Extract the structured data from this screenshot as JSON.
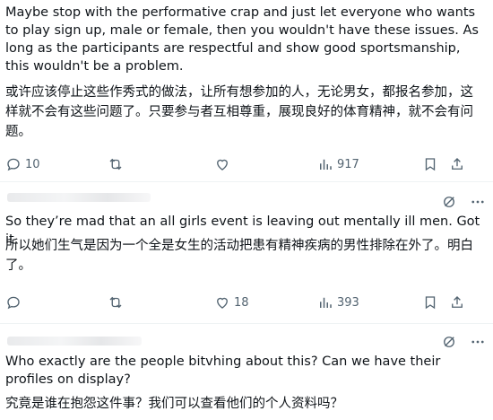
{
  "posts": [
    {
      "text_en": "Maybe stop with the performative crap and just let everyone who wants to play sign up, male or female, then you wouldn't have these issues. As long as the participants are respectful and show good sportsmanship, this wouldn't be a problem.",
      "text_zh": "或许应该停止这些作秀式的做法，让所有想参加的人，无论男女，都报名参加，这样就不会有这些问题了。只要参与者互相尊重，展现良好的体育精神，就不会有问题。",
      "replies": "10",
      "reposts": "",
      "likes": "",
      "views": "917"
    },
    {
      "text_en": "So they’re mad that an all girls event is leaving out mentally ill men. Got it.",
      "text_zh": "所以她们生气是因为一个全是女生的活动把患有精神疾病的男性排除在外了。明白了。",
      "replies": "",
      "reposts": "",
      "likes": "18",
      "views": "393"
    },
    {
      "text_en": "Who exactly are the people bitvhing about this? Can we have their profiles on display?",
      "text_zh": "究竟是谁在抱怨这件事？我们可以查看他们的个人资料吗？"
    }
  ],
  "icons": {
    "reply": "reply-icon",
    "repost": "repost-icon",
    "like": "heart-icon",
    "views": "views-icon",
    "bookmark": "bookmark-icon",
    "share": "share-icon",
    "grok": "grok-icon",
    "more": "more-icon"
  },
  "colors": {
    "text": "#0f1419",
    "muted": "#536471",
    "divider": "#eff3f4"
  }
}
